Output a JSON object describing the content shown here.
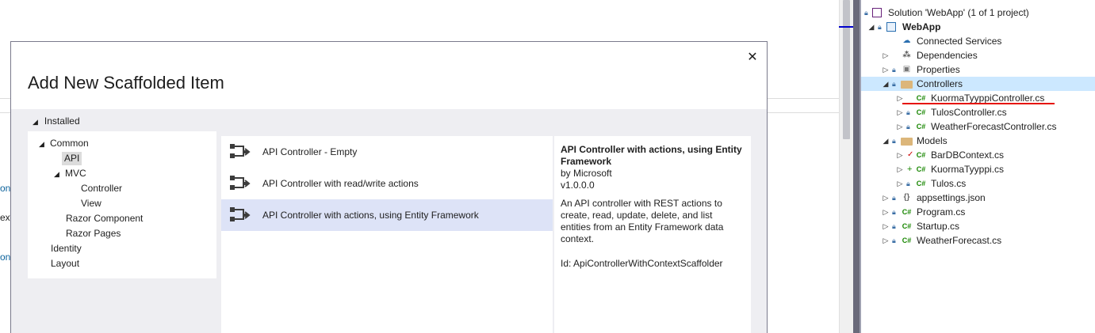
{
  "background": {
    "edge_texts": [
      "on",
      "ext",
      "on"
    ]
  },
  "solution_explorer": {
    "items": [
      {
        "label": "Solution 'WebApp' (1 of 1 project)",
        "icon": "solution-icon"
      },
      {
        "label": "WebApp",
        "icon": "project-icon"
      },
      {
        "label": "Connected Services",
        "icon": "connected-services-icon"
      },
      {
        "label": "Dependencies",
        "icon": "dependencies-icon"
      },
      {
        "label": "Properties",
        "icon": "properties-icon"
      },
      {
        "label": "Controllers",
        "icon": "folder-icon"
      },
      {
        "label": "KuormaTyyppiController.cs",
        "icon": "csharp-file-icon"
      },
      {
        "label": "TulosController.cs",
        "icon": "csharp-file-icon"
      },
      {
        "label": "WeatherForecastController.cs",
        "icon": "csharp-file-icon"
      },
      {
        "label": "Models",
        "icon": "folder-icon"
      },
      {
        "label": "BarDBContext.cs",
        "icon": "csharp-file-icon"
      },
      {
        "label": "KuormaTyyppi.cs",
        "icon": "csharp-file-icon"
      },
      {
        "label": "Tulos.cs",
        "icon": "csharp-file-icon"
      },
      {
        "label": "appsettings.json",
        "icon": "json-file-icon"
      },
      {
        "label": "Program.cs",
        "icon": "csharp-file-icon"
      },
      {
        "label": "Startup.cs",
        "icon": "csharp-file-icon"
      },
      {
        "label": "WeatherForecast.cs",
        "icon": "csharp-file-icon"
      }
    ],
    "selected": "Controllers",
    "csharp_glyph": "C#"
  },
  "dialog": {
    "title": "Add New Scaffolded Item",
    "close_glyph": "✕",
    "installed_label": "Installed",
    "categories": [
      {
        "label": "Common"
      },
      {
        "label": "API"
      },
      {
        "label": "MVC"
      },
      {
        "label": "Controller"
      },
      {
        "label": "View"
      },
      {
        "label": "Razor Component"
      },
      {
        "label": "Razor Pages"
      },
      {
        "label": "Identity"
      },
      {
        "label": "Layout"
      }
    ],
    "selected_category": "API",
    "templates": [
      {
        "label": "API Controller - Empty"
      },
      {
        "label": "API Controller with read/write actions"
      },
      {
        "label": "API Controller with actions, using Entity Framework"
      }
    ],
    "selected_template": "API Controller with actions, using Entity Framework",
    "description": {
      "title": "API Controller with actions, using Entity Framework",
      "author": "by Microsoft",
      "version": "v1.0.0.0",
      "body": "An API controller with REST actions to create, read, update, delete, and list entities from an Entity Framework data context.",
      "id": "Id: ApiControllerWithContextScaffolder"
    }
  }
}
